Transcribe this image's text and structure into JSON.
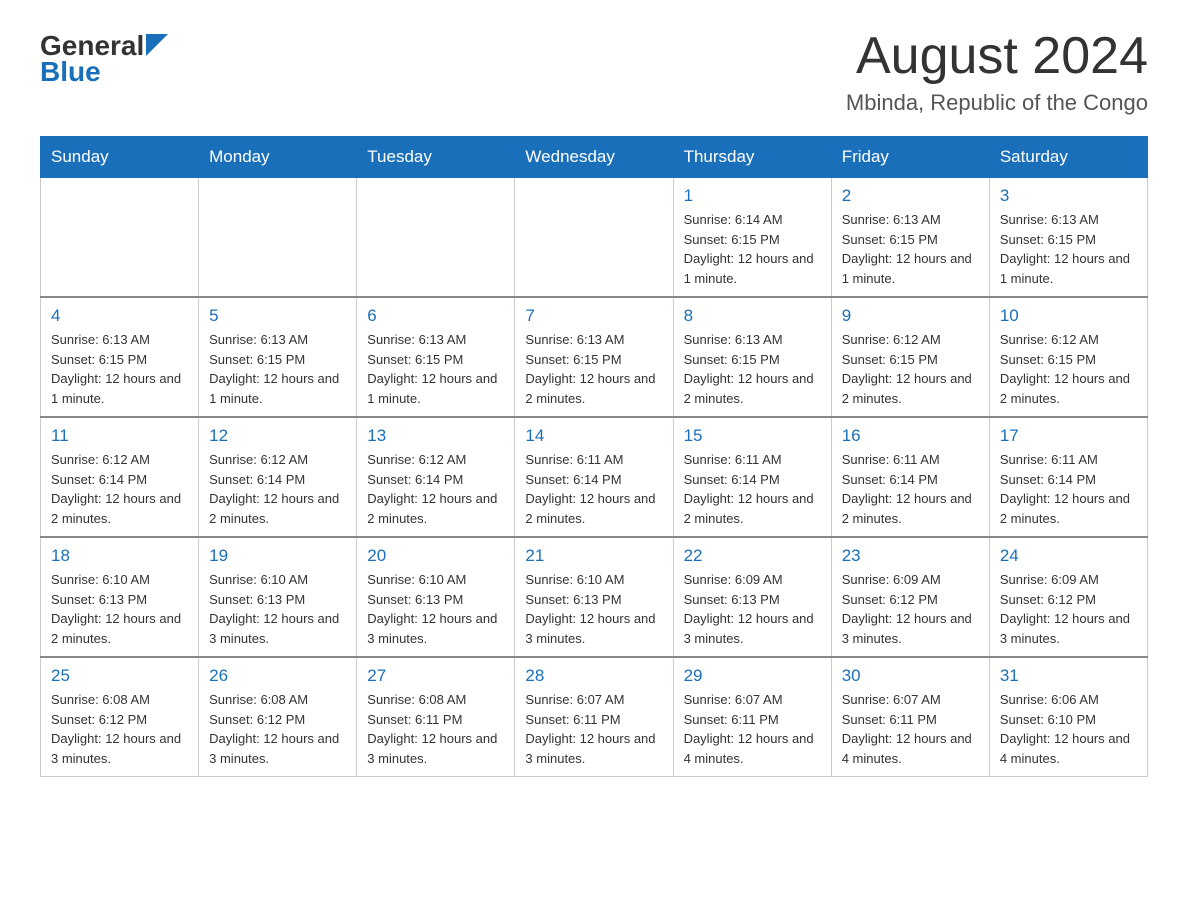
{
  "header": {
    "logo_general": "General",
    "logo_blue": "Blue",
    "month_title": "August 2024",
    "location": "Mbinda, Republic of the Congo"
  },
  "days_of_week": [
    "Sunday",
    "Monday",
    "Tuesday",
    "Wednesday",
    "Thursday",
    "Friday",
    "Saturday"
  ],
  "weeks": [
    [
      {
        "day": "",
        "info": ""
      },
      {
        "day": "",
        "info": ""
      },
      {
        "day": "",
        "info": ""
      },
      {
        "day": "",
        "info": ""
      },
      {
        "day": "1",
        "info": "Sunrise: 6:14 AM\nSunset: 6:15 PM\nDaylight: 12 hours and 1 minute."
      },
      {
        "day": "2",
        "info": "Sunrise: 6:13 AM\nSunset: 6:15 PM\nDaylight: 12 hours and 1 minute."
      },
      {
        "day": "3",
        "info": "Sunrise: 6:13 AM\nSunset: 6:15 PM\nDaylight: 12 hours and 1 minute."
      }
    ],
    [
      {
        "day": "4",
        "info": "Sunrise: 6:13 AM\nSunset: 6:15 PM\nDaylight: 12 hours and 1 minute."
      },
      {
        "day": "5",
        "info": "Sunrise: 6:13 AM\nSunset: 6:15 PM\nDaylight: 12 hours and 1 minute."
      },
      {
        "day": "6",
        "info": "Sunrise: 6:13 AM\nSunset: 6:15 PM\nDaylight: 12 hours and 1 minute."
      },
      {
        "day": "7",
        "info": "Sunrise: 6:13 AM\nSunset: 6:15 PM\nDaylight: 12 hours and 2 minutes."
      },
      {
        "day": "8",
        "info": "Sunrise: 6:13 AM\nSunset: 6:15 PM\nDaylight: 12 hours and 2 minutes."
      },
      {
        "day": "9",
        "info": "Sunrise: 6:12 AM\nSunset: 6:15 PM\nDaylight: 12 hours and 2 minutes."
      },
      {
        "day": "10",
        "info": "Sunrise: 6:12 AM\nSunset: 6:15 PM\nDaylight: 12 hours and 2 minutes."
      }
    ],
    [
      {
        "day": "11",
        "info": "Sunrise: 6:12 AM\nSunset: 6:14 PM\nDaylight: 12 hours and 2 minutes."
      },
      {
        "day": "12",
        "info": "Sunrise: 6:12 AM\nSunset: 6:14 PM\nDaylight: 12 hours and 2 minutes."
      },
      {
        "day": "13",
        "info": "Sunrise: 6:12 AM\nSunset: 6:14 PM\nDaylight: 12 hours and 2 minutes."
      },
      {
        "day": "14",
        "info": "Sunrise: 6:11 AM\nSunset: 6:14 PM\nDaylight: 12 hours and 2 minutes."
      },
      {
        "day": "15",
        "info": "Sunrise: 6:11 AM\nSunset: 6:14 PM\nDaylight: 12 hours and 2 minutes."
      },
      {
        "day": "16",
        "info": "Sunrise: 6:11 AM\nSunset: 6:14 PM\nDaylight: 12 hours and 2 minutes."
      },
      {
        "day": "17",
        "info": "Sunrise: 6:11 AM\nSunset: 6:14 PM\nDaylight: 12 hours and 2 minutes."
      }
    ],
    [
      {
        "day": "18",
        "info": "Sunrise: 6:10 AM\nSunset: 6:13 PM\nDaylight: 12 hours and 2 minutes."
      },
      {
        "day": "19",
        "info": "Sunrise: 6:10 AM\nSunset: 6:13 PM\nDaylight: 12 hours and 3 minutes."
      },
      {
        "day": "20",
        "info": "Sunrise: 6:10 AM\nSunset: 6:13 PM\nDaylight: 12 hours and 3 minutes."
      },
      {
        "day": "21",
        "info": "Sunrise: 6:10 AM\nSunset: 6:13 PM\nDaylight: 12 hours and 3 minutes."
      },
      {
        "day": "22",
        "info": "Sunrise: 6:09 AM\nSunset: 6:13 PM\nDaylight: 12 hours and 3 minutes."
      },
      {
        "day": "23",
        "info": "Sunrise: 6:09 AM\nSunset: 6:12 PM\nDaylight: 12 hours and 3 minutes."
      },
      {
        "day": "24",
        "info": "Sunrise: 6:09 AM\nSunset: 6:12 PM\nDaylight: 12 hours and 3 minutes."
      }
    ],
    [
      {
        "day": "25",
        "info": "Sunrise: 6:08 AM\nSunset: 6:12 PM\nDaylight: 12 hours and 3 minutes."
      },
      {
        "day": "26",
        "info": "Sunrise: 6:08 AM\nSunset: 6:12 PM\nDaylight: 12 hours and 3 minutes."
      },
      {
        "day": "27",
        "info": "Sunrise: 6:08 AM\nSunset: 6:11 PM\nDaylight: 12 hours and 3 minutes."
      },
      {
        "day": "28",
        "info": "Sunrise: 6:07 AM\nSunset: 6:11 PM\nDaylight: 12 hours and 3 minutes."
      },
      {
        "day": "29",
        "info": "Sunrise: 6:07 AM\nSunset: 6:11 PM\nDaylight: 12 hours and 4 minutes."
      },
      {
        "day": "30",
        "info": "Sunrise: 6:07 AM\nSunset: 6:11 PM\nDaylight: 12 hours and 4 minutes."
      },
      {
        "day": "31",
        "info": "Sunrise: 6:06 AM\nSunset: 6:10 PM\nDaylight: 12 hours and 4 minutes."
      }
    ]
  ]
}
